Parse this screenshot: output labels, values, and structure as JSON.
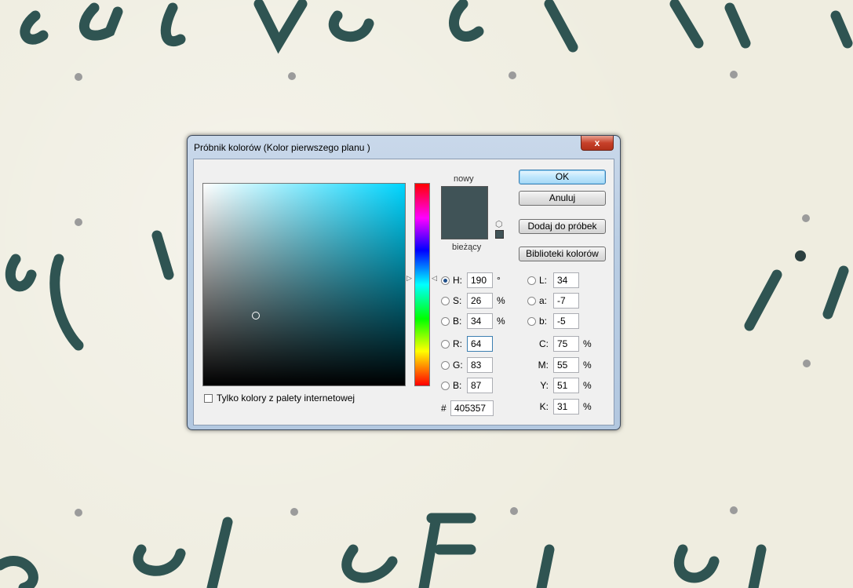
{
  "dialog": {
    "title": "Próbnik kolorów (Kolor pierwszego planu )",
    "close_label": "x",
    "selected_color_hex_value": "#405357",
    "new_color": "#405357",
    "current_color": "#405357"
  },
  "swatches": {
    "new_label": "nowy",
    "current_label": "bieżący"
  },
  "buttons": {
    "ok": "OK",
    "cancel": "Anuluj",
    "add_to_swatches": "Dodaj do próbek",
    "color_libraries": "Biblioteki kolorów"
  },
  "web_only_label": "Tylko kolory z palety internetowej",
  "hsb": {
    "h": {
      "label": "H:",
      "value": "190",
      "unit": "°"
    },
    "s": {
      "label": "S:",
      "value": "26",
      "unit": "%"
    },
    "b": {
      "label": "B:",
      "value": "34",
      "unit": "%"
    }
  },
  "rgb": {
    "r": {
      "label": "R:",
      "value": "64"
    },
    "g": {
      "label": "G:",
      "value": "83"
    },
    "b": {
      "label": "B:",
      "value": "87"
    }
  },
  "lab": {
    "l": {
      "label": "L:",
      "value": "34"
    },
    "a": {
      "label": "a:",
      "value": "-7"
    },
    "b": {
      "label": "b:",
      "value": "-5"
    }
  },
  "cmyk": {
    "c": {
      "label": "C:",
      "value": "75",
      "unit": "%"
    },
    "m": {
      "label": "M:",
      "value": "55",
      "unit": "%"
    },
    "y": {
      "label": "Y:",
      "value": "51",
      "unit": "%"
    },
    "k": {
      "label": "K:",
      "value": "31",
      "unit": "%"
    }
  },
  "hex": {
    "label": "#",
    "value": "405357"
  },
  "colors": {
    "ink": "#2f5a57",
    "paper": "#efede0",
    "dots": "#9b9b9b"
  },
  "icons": {
    "cube": "cube-icon",
    "close": "close-icon",
    "hue_slider_arrow": "triangle-arrow-icon"
  }
}
